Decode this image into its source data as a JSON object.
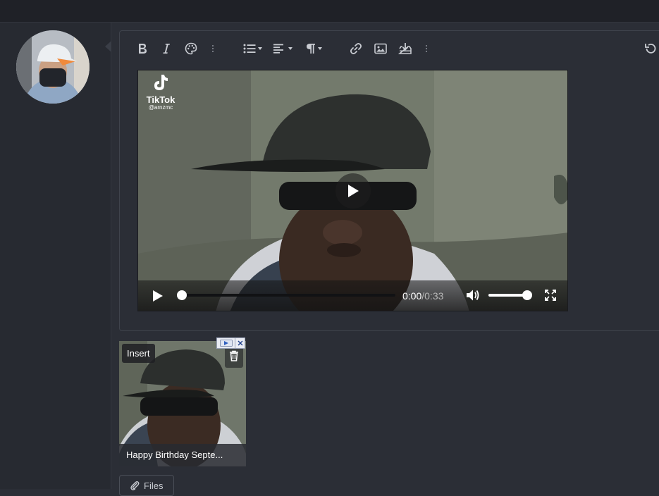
{
  "editor": {
    "toolbar": {
      "bold_icon": "bold-icon",
      "italic_icon": "italic-icon",
      "palette_icon": "palette-icon",
      "list_icon": "list-icon",
      "align_icon": "align-icon",
      "paragraph_icon": "paragraph-icon",
      "link_icon": "link-icon",
      "image_icon": "image-icon",
      "insert_icon": "insert-icon",
      "undo_icon": "undo-icon"
    }
  },
  "video": {
    "watermark_brand": "TikTok",
    "watermark_handle": "@arnzmc",
    "time_current": "0:00",
    "time_separator": " / ",
    "time_total": "0:33",
    "progress": 0,
    "volume": 1.0
  },
  "attachment": {
    "insert_label": "Insert",
    "caption": "Happy Birthday Septe..."
  },
  "footer": {
    "files_label": "Files"
  }
}
